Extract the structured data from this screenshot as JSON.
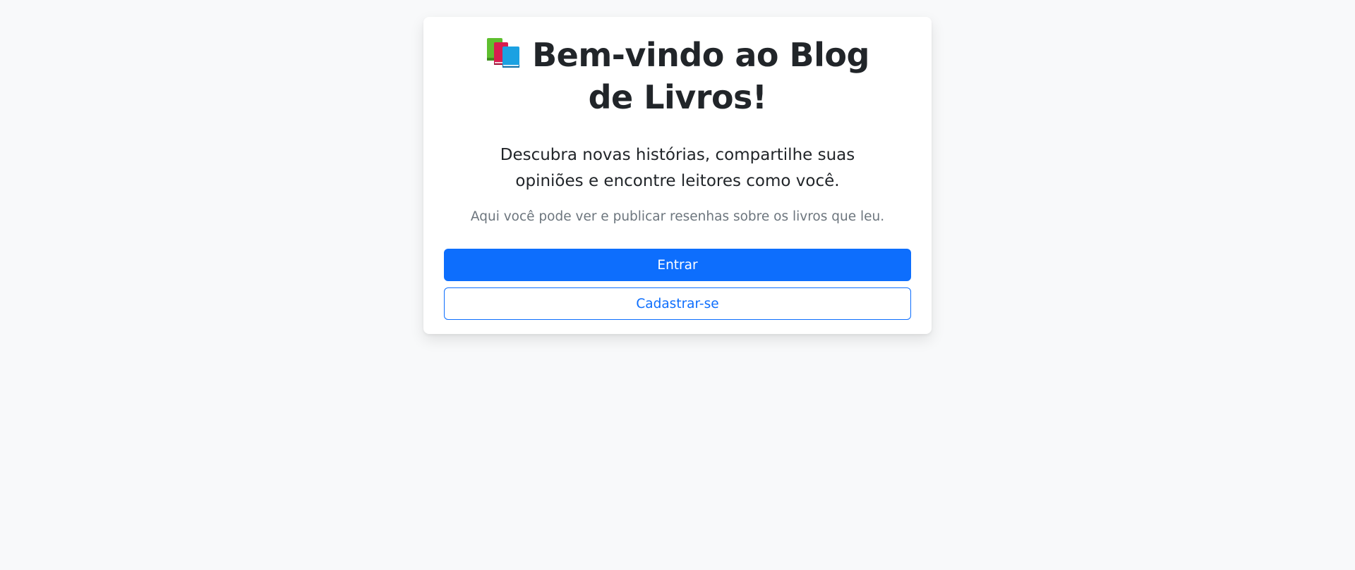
{
  "welcome": {
    "icon": "books-icon",
    "title": "Bem-vindo ao Blog de Livros!",
    "lead": "Descubra novas histórias, compartilhe suas opiniões e encontre leitores como você.",
    "subtitle": "Aqui você pode ver e publicar resenhas sobre os livros que leu.",
    "login_label": "Entrar",
    "register_label": "Cadastrar-se"
  },
  "colors": {
    "background": "#f8f9fa",
    "primary": "#0d6efd",
    "text": "#212529",
    "muted": "#6c757d"
  }
}
